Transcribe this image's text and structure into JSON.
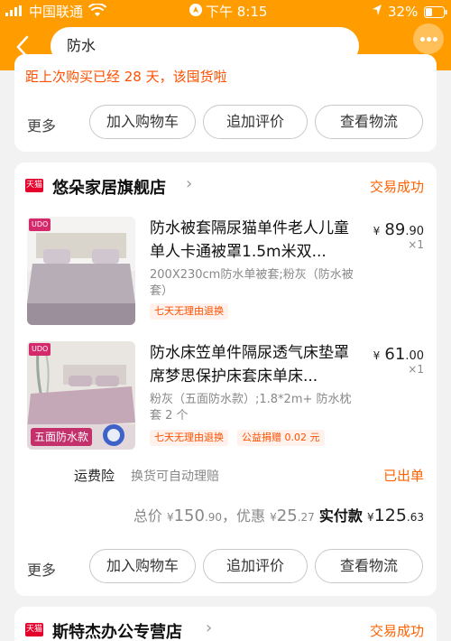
{
  "status_bar": {
    "carrier": "中国联通",
    "time": "下午 8:15",
    "battery": "32%"
  },
  "nav": {
    "search_value": "防水"
  },
  "order1": {
    "notice": "距上次购买已经 28 天，该囤货啦",
    "more": "更多",
    "actions": [
      "加入购物车",
      "追加评价",
      "查看物流"
    ]
  },
  "order2": {
    "badge": "天猫",
    "shop": "悠朵家居旗舰店",
    "status": "交易成功",
    "items": [
      {
        "title": "防水被套隔尿猫单件老人儿童单人卡通被罩1.5m米双...",
        "spec": "200X230cm防水单被套;粉灰（防水被套）",
        "tags": [
          "七天无理由退换"
        ],
        "price_symbol": "¥",
        "price_int": "89",
        "price_dec": ".90",
        "qty": "×1",
        "thumb_brand": "UDO"
      },
      {
        "title": "防水床笠单件隔尿透气床垫罩席梦思保护床套床单床...",
        "spec": "粉灰（五面防水款）;1.8*2m+ 防水枕套 2 个",
        "tags": [
          "七天无理由退换",
          "公益捐赠 0.02 元"
        ],
        "price_symbol": "¥",
        "price_int": "61",
        "price_dec": ".00",
        "qty": "×1",
        "thumb_brand": "UDO",
        "thumb_tag": "五面防水款"
      }
    ],
    "insurance": {
      "label": "运费险",
      "desc": "换货可自动理赔",
      "status": "已出单"
    },
    "totals": {
      "total_label": "总价",
      "total_int": "150",
      "total_dec": ".90",
      "discount_label": "，优惠",
      "discount_int": "25",
      "discount_dec": ".27",
      "paid_label": "实付款",
      "paid_int": "125",
      "paid_dec": ".63",
      "currency": "¥"
    },
    "more": "更多",
    "actions": [
      "加入购物车",
      "追加评价",
      "查看物流"
    ]
  },
  "order3": {
    "badge": "天猫",
    "shop": "斯特杰办公专营店",
    "status": "交易成功"
  },
  "colors": {
    "brand_orange": "#ff9d00",
    "accent": "#ff5000",
    "tmall_red": "#e4002b"
  }
}
